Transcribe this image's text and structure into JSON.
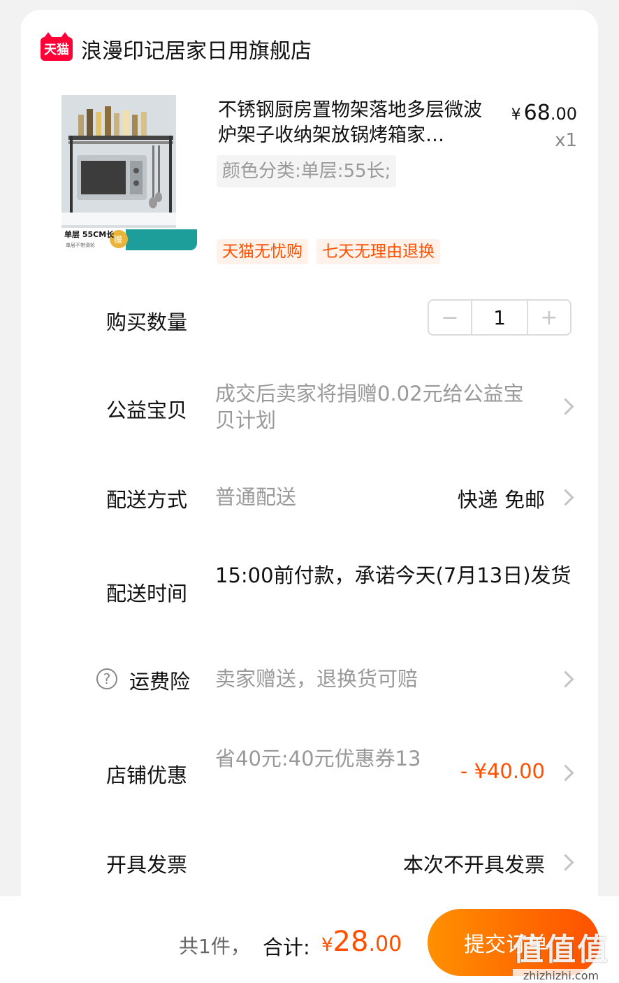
{
  "store": {
    "logo_text": "天猫",
    "name": "浪漫印记居家日用旗舰店"
  },
  "product": {
    "title": "不锈钢厨房置物架落地多层微波炉架子收纳架放锅烤箱家…",
    "price_symbol": "¥",
    "price_int": "68",
    "price_dec": ".00",
    "quantity_text": "x1",
    "sku": "颜色分类:单层:55长;",
    "image_caption": "单层 55CM长",
    "image_caption_sub": "单层不带滑轮",
    "image_gift": "赠",
    "service_tags": [
      "天猫无忧购",
      "七天无理由退换"
    ]
  },
  "rows": {
    "quantity": {
      "label": "购买数量",
      "value": "1",
      "minus": "−",
      "plus": "+"
    },
    "charity": {
      "label": "公益宝贝",
      "value": "成交后卖家将捐赠0.02元给公益宝贝计划"
    },
    "shipping": {
      "label": "配送方式",
      "value": "普通配送",
      "right": "快递 免邮"
    },
    "delivery_time": {
      "label": "配送时间",
      "value": "15:00前付款，承诺今天(7月13日)发货"
    },
    "insurance": {
      "icon": "?",
      "label": "运费险",
      "value": "卖家赠送，退换货可赔"
    },
    "discount": {
      "label": "店铺优惠",
      "value": "省40元:40元优惠券13",
      "right": "- ¥40.00"
    },
    "invoice": {
      "label": "开具发票",
      "right": "本次不开具发票"
    }
  },
  "footer": {
    "count": "共1件，",
    "total_label": "合计:",
    "total_symbol": "¥",
    "total_int": "28",
    "total_dec": ".00",
    "submit": "提交订单"
  },
  "watermark": {
    "big": "值值值",
    "small": "zhizhizhi.com"
  },
  "colors": {
    "accent": "#ff5000",
    "tmall_red": "#ff0036",
    "muted": "#999999"
  }
}
